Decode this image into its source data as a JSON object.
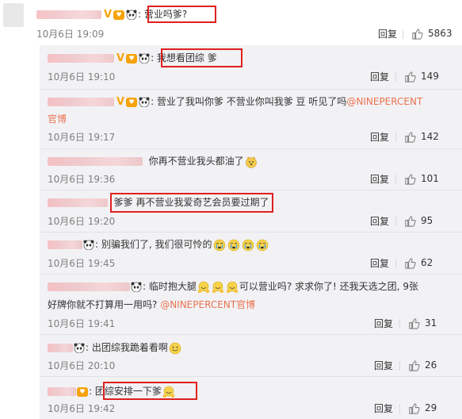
{
  "top_comment": {
    "text": "营业吗爹?",
    "time": "10月6日 19:09",
    "reply_label": "回复",
    "likes": "5863"
  },
  "replies": [
    {
      "text": "我想看团综 爹",
      "time": "10月6日 19:10",
      "reply_label": "回复",
      "likes": "149"
    },
    {
      "text_a": "营业了我叫你爹 不营业你叫我爹 豆 听见了吗",
      "mention": "@NINEPERCENT",
      "text_b": "官博",
      "time": "10月6日 19:17",
      "reply_label": "回复",
      "likes": "142"
    },
    {
      "text": "你再不营业我头都油了",
      "time": "10月6日 19:36",
      "reply_label": "回复",
      "likes": "101"
    },
    {
      "text": "爹爹 再不营业我爱奇艺会员要过期了",
      "time": "10月6日 19:20",
      "reply_label": "回复",
      "likes": "95"
    },
    {
      "text": "别骗我们了, 我们很可怜的",
      "time": "10月6日 19:45",
      "reply_label": "回复",
      "likes": "62"
    },
    {
      "text_a": "临时抱大腿",
      "text_b": "可以营业吗? 求求你了! 还我天选之团, 9张",
      "text_c": "好牌你就不打算用一用吗? ",
      "mention": "@NINEPERCENT官博",
      "time": "10月6日 19:41",
      "reply_label": "回复",
      "likes": "31"
    },
    {
      "text": "出团综我跪着看啊",
      "time": "10月6日 20:10",
      "reply_label": "回复",
      "likes": "26"
    },
    {
      "text": "团综安排一下爹",
      "time": "10月6日 19:42",
      "reply_label": "回复",
      "likes": "29"
    }
  ],
  "icons": {
    "like": "thumbs-up-icon",
    "panda": "panda-emoji-icon",
    "v": "verified-v-icon"
  },
  "colors": {
    "link": "#eb7350",
    "highlight": "#e02020",
    "reply_bg": "#f2f2f5"
  }
}
